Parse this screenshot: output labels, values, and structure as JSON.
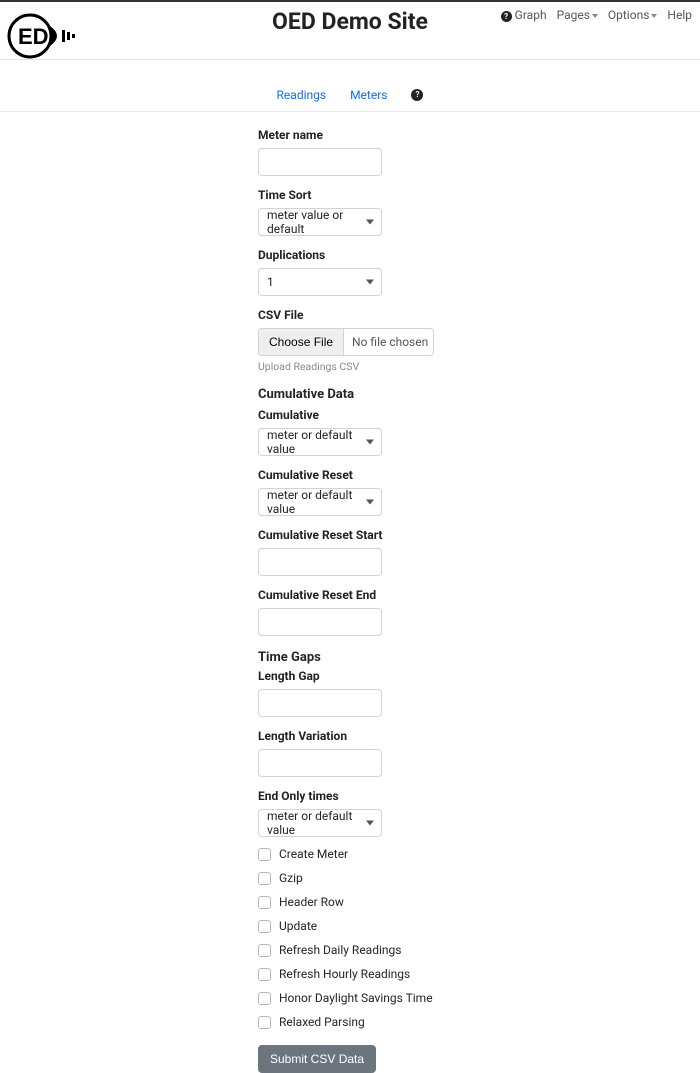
{
  "header": {
    "title": "OED Demo Site",
    "nav": {
      "graph": "Graph",
      "pages": "Pages",
      "options": "Options",
      "help": "Help"
    }
  },
  "tabs": {
    "readings": "Readings",
    "meters": "Meters"
  },
  "form": {
    "meter_name_label": "Meter name",
    "meter_name_value": "",
    "time_sort_label": "Time Sort",
    "time_sort_value": "meter value or default",
    "duplications_label": "Duplications",
    "duplications_value": "1",
    "csv_file_label": "CSV File",
    "choose_file_label": "Choose File",
    "no_file_text": "No file chosen",
    "upload_hint": "Upload Readings CSV",
    "cumulative_data_header": "Cumulative Data",
    "cumulative_label": "Cumulative",
    "cumulative_value": "meter or default value",
    "cumulative_reset_label": "Cumulative Reset",
    "cumulative_reset_value": "meter or default value",
    "cumulative_reset_start_label": "Cumulative Reset Start",
    "cumulative_reset_start_value": "",
    "cumulative_reset_end_label": "Cumulative Reset End",
    "cumulative_reset_end_value": "",
    "time_gaps_header": "Time Gaps",
    "length_gap_label": "Length Gap",
    "length_gap_value": "",
    "length_variation_label": "Length Variation",
    "length_variation_value": "",
    "end_only_label": "End Only times",
    "end_only_value": "meter or default value",
    "checks": {
      "create_meter": "Create Meter",
      "gzip": "Gzip",
      "header_row": "Header Row",
      "update": "Update",
      "refresh_daily": "Refresh Daily Readings",
      "refresh_hourly": "Refresh Hourly Readings",
      "honor_dst": "Honor Daylight Savings Time",
      "relaxed_parsing": "Relaxed Parsing"
    },
    "submit_label": "Submit CSV Data"
  }
}
